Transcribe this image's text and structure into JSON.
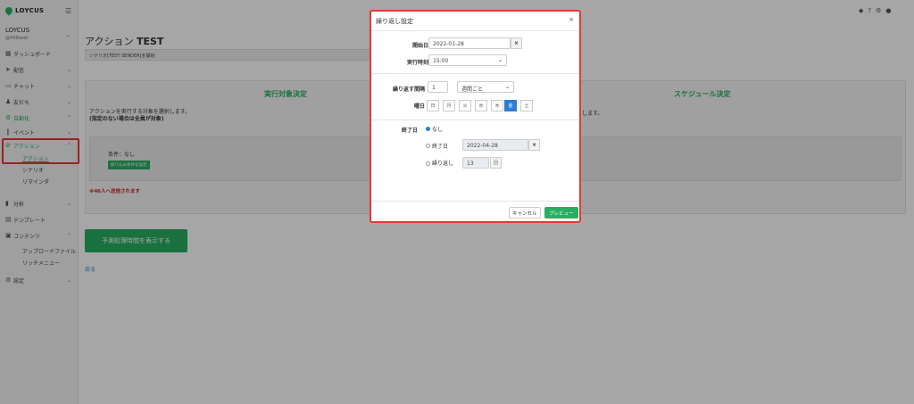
{
  "sidebar": {
    "brand": "LOYCUS",
    "account_name": "LOYCUS",
    "account_sub": "@498oeol",
    "items": [
      {
        "icon": "dashboard-icon",
        "glyph": "▦",
        "label": "ダッシュボード"
      },
      {
        "icon": "send-icon",
        "glyph": "➤",
        "label": "配信"
      },
      {
        "icon": "chat-icon",
        "glyph": "💬",
        "label": "チャット"
      },
      {
        "icon": "friends-icon",
        "glyph": "👥",
        "label": "友だち"
      },
      {
        "icon": "automation-icon",
        "glyph": "⚙",
        "label": "自動化"
      },
      {
        "icon": "event-icon",
        "glyph": "❙",
        "label": "イベント"
      },
      {
        "icon": "action-icon",
        "glyph": "⊘",
        "label": "アクション"
      },
      {
        "icon": "analysis-icon",
        "glyph": "▮",
        "label": "分析"
      },
      {
        "icon": "template-icon",
        "glyph": "▤",
        "label": "テンプレート"
      },
      {
        "icon": "content-icon",
        "glyph": "▣",
        "label": "コンテンツ"
      },
      {
        "icon": "settings-icon",
        "glyph": "⚙",
        "label": "設定"
      }
    ],
    "subitems": {
      "action": "アクション",
      "scenario": "シナリオ",
      "reminder": "リマインダ",
      "upload": "アップロードファイル",
      "rich_menu": "リッチメニュー"
    }
  },
  "main": {
    "title_prefix": "アクション",
    "title_bold": "TEST",
    "scenario_text": "シナリオ[TEST SENDER]を開始",
    "target_title": "実行対象決定",
    "schedule_title": "スケジュール決定",
    "target_desc1": "アクションを実行する対象を選択します。",
    "target_desc2": "(指定のない場合は全員が対象)",
    "schedule_desc": "します。",
    "condition_text": "条件：なし",
    "narrow_button": "絞り込み条件を設定",
    "note": "※46人へ送信されます",
    "estimate_button": "予測処理時間を表示する",
    "back_link": "戻る"
  },
  "modal": {
    "title": "繰り返し設定",
    "close": "×",
    "start_label": "開始日",
    "start_date": "2022-01-28",
    "time_label": "実行時刻",
    "time_value": "15:00",
    "interval_label": "繰り返す間隔",
    "interval_value": "1",
    "interval_unit": "週間ごと",
    "weekday_label": "曜日",
    "days": [
      "日",
      "月",
      "火",
      "水",
      "木",
      "金",
      "土"
    ],
    "end_label": "終了日",
    "end_none": "なし",
    "end_date_label": "終了日",
    "end_date_value": "2022-04-28",
    "repeat_label": "繰り返し",
    "repeat_count": "13",
    "repeat_unit": "回",
    "cancel": "キャンセル",
    "preview": "プレビュー"
  },
  "colors": {
    "accent": "#27ae60",
    "highlight": "#e53935",
    "selected_day": "#2d7dd2"
  }
}
